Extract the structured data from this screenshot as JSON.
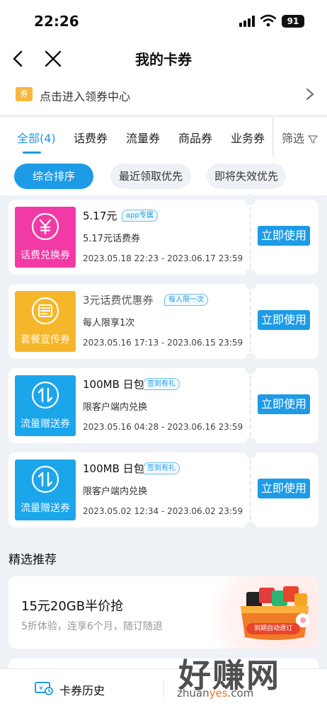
{
  "status_bar": {
    "time": "22:26",
    "battery": "91"
  },
  "nav": {
    "title": "我的卡券"
  },
  "coupon_center": {
    "tag": "券",
    "label": "点击进入领券中心"
  },
  "tabs": [
    {
      "label": "全部(4)",
      "active": true
    },
    {
      "label": "话费券"
    },
    {
      "label": "流量券"
    },
    {
      "label": "商品券"
    },
    {
      "label": "业务券"
    }
  ],
  "filter_label": "筛选",
  "sorts": [
    {
      "label": "综合排序",
      "active": true
    },
    {
      "label": "最近领取优先"
    },
    {
      "label": "即将失效优先"
    }
  ],
  "coupons": [
    {
      "type_label": "话费兑换券",
      "icon": "yuan-icon",
      "color": "#f23aa6",
      "title": "5.17元",
      "badge": "app专属",
      "subtitle": "5.17元话费券",
      "validity": "2023.05.18 22:23 - 2023.06.17 23:59",
      "action": "立即使用"
    },
    {
      "type_label": "套餐宣传券",
      "icon": "package-icon",
      "color": "#f5b62a",
      "title": "3元话费优惠券",
      "badge": "每人限一次",
      "subtitle": "每人限享1次",
      "validity": "2023.05.16 17:13 - 2023.06.15 23:59",
      "action": "立即使用"
    },
    {
      "type_label": "流量赠送券",
      "icon": "data-transfer-icon",
      "color": "#1ba6ec",
      "title": "100MB 日包",
      "badge": "签到有礼",
      "subtitle": "限客户端内兑换",
      "validity": "2023.05.16 04:28 - 2023.06.16 23:59",
      "action": "立即使用"
    },
    {
      "type_label": "流量赠送券",
      "icon": "data-transfer-icon",
      "color": "#1ba6ec",
      "title": "100MB 日包",
      "badge": "签到有礼",
      "subtitle": "限客户端内兑换",
      "validity": "2023.05.02 12:34 - 2023.06.02 23:59",
      "action": "立即使用"
    }
  ],
  "recommend": {
    "section_title": "精选推荐",
    "title": "15元20GB半价抢",
    "subtitle": "5折体验，连享6个月，随订随退",
    "gift_label": "到期自动退订"
  },
  "bottom_bar": {
    "history_label": "卡券历史"
  },
  "watermark": {
    "text": "好赚网",
    "url_prefix": "zhuan",
    "url_highlight": "yes",
    "url_suffix": ".com"
  },
  "colors": {
    "accent": "#1d9be6",
    "page_bg": "#eef1f6"
  }
}
